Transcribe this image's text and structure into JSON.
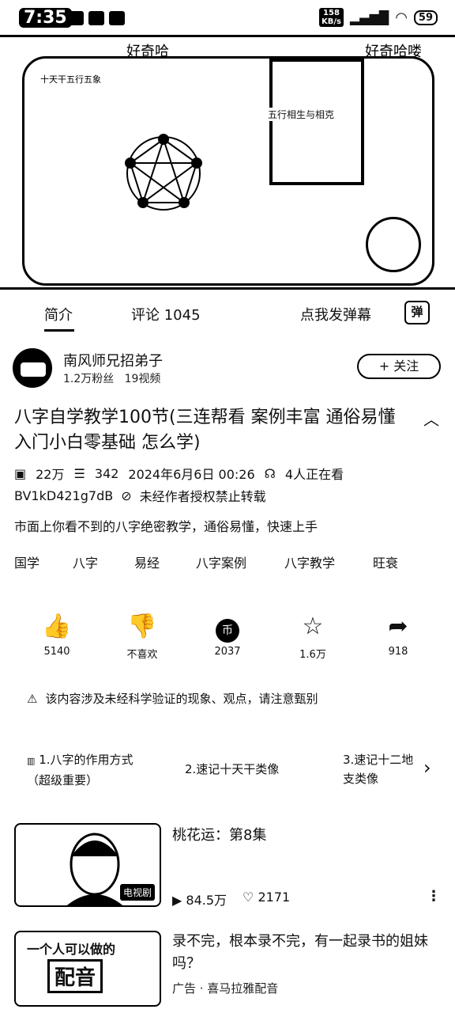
{
  "status_bar": {
    "time": "7:35",
    "net_speed": "158\nKB/s",
    "battery": "59"
  },
  "video": {
    "overlay_left": "好奇哈",
    "overlay_right": "好奇哈喽",
    "chart_header": "十天干五行五象",
    "board_caption": "五行相生与相克"
  },
  "tabs": {
    "intro": "简介",
    "comments": "评论 1045",
    "danmu_prompt": "点我发弹幕",
    "danmu_icon": "弹"
  },
  "uploader": {
    "name": "南风师兄招弟子",
    "stats": "1.2万粉丝   19视频",
    "follow": "+ 关注"
  },
  "title": "八字自学教学100节(三连帮看 案例丰富 通俗易懂 入门小白零基础 怎么学)",
  "meta": {
    "views": "22万",
    "danmaku": "342",
    "datetime": "2024年6月6日 00:26",
    "watching": "4人正在看",
    "bvid": "BV1kD421g7dB",
    "copyright": "未经作者授权禁止转载"
  },
  "description": "市面上你看不到的八字绝密教学，通俗易懂，快速上手",
  "tags": [
    "国学",
    "八字",
    "易经",
    "八字案例",
    "八字教学",
    "旺衰"
  ],
  "actions": [
    {
      "icon": "thumbs-up-icon",
      "glyph": "👍",
      "label": "5140"
    },
    {
      "icon": "thumbs-down-icon",
      "glyph": "👎",
      "label": "不喜欢"
    },
    {
      "icon": "coin-icon",
      "glyph": "币",
      "label": "2037"
    },
    {
      "icon": "star-icon",
      "glyph": "☆",
      "label": "1.6万"
    },
    {
      "icon": "share-icon",
      "glyph": "➦",
      "label": "918"
    }
  ],
  "warning": "该内容涉及未经科学验证的现象、观点，请注意甄别",
  "episodes": [
    {
      "label": "1.八字的作用方式（超级重要）"
    },
    {
      "label": "2.速记十天干类像"
    },
    {
      "label": "3.速记十二地支类像"
    }
  ],
  "recommendations": [
    {
      "title": "桃花运：第8集",
      "badge": "电视剧",
      "views": "84.5万",
      "likes": "2171"
    },
    {
      "title": "录不完，根本录不完，有一起录书的姐妹吗？",
      "thumb_text1": "一个人可以做的",
      "thumb_text2": "配音",
      "ad": "广告 · 喜马拉雅配音"
    }
  ]
}
